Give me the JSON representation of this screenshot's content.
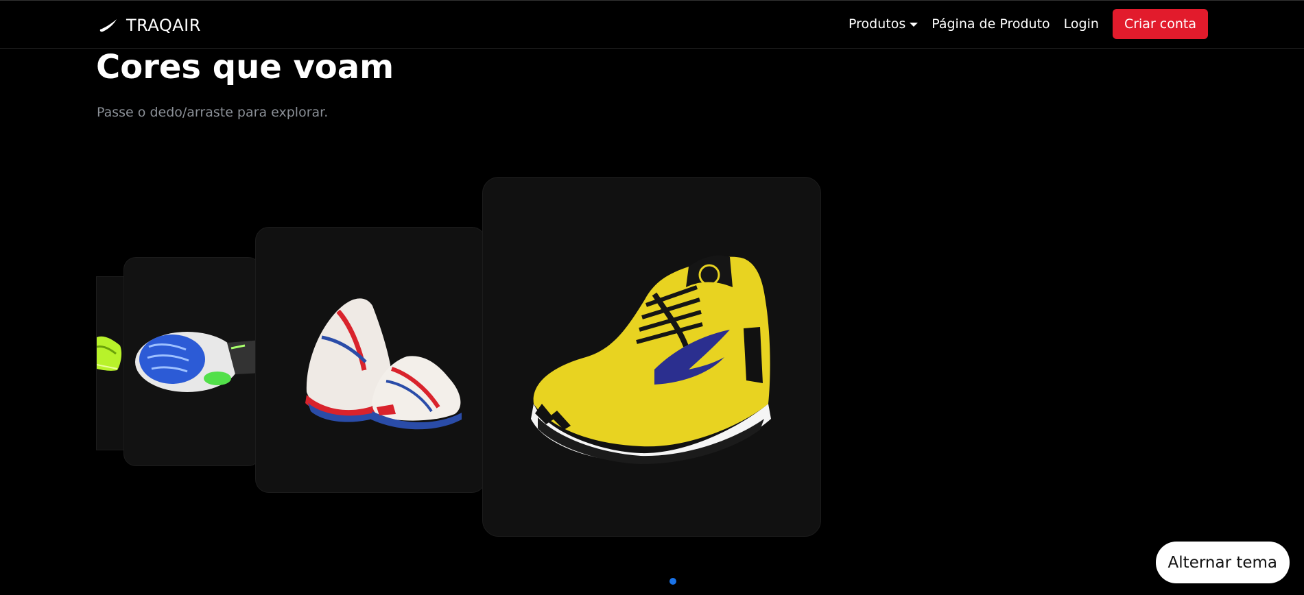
{
  "brand": {
    "name": "TRAQAIR",
    "icon": "swoosh-icon"
  },
  "nav": {
    "produtos": "Produtos",
    "pagina_produto": "Página de Produto",
    "login": "Login",
    "criar_conta": "Criar conta"
  },
  "hero": {
    "title": "Cores que voam",
    "subtitle": "Passe o dedo/arraste para explorar."
  },
  "carousel": {
    "cards": [
      {
        "product": "yellow-running-shoe"
      },
      {
        "product": "white-red-blue-running-shoes"
      },
      {
        "product": "blue-sole-running-shoe"
      },
      {
        "product": "neon-green-running-shoe"
      }
    ],
    "active_index": 0
  },
  "theme_toggle": {
    "label": "Alternar tema"
  },
  "colors": {
    "accent": "#e21b2c",
    "dot": "#1a73e8",
    "background": "#000000",
    "card": "#121212"
  }
}
